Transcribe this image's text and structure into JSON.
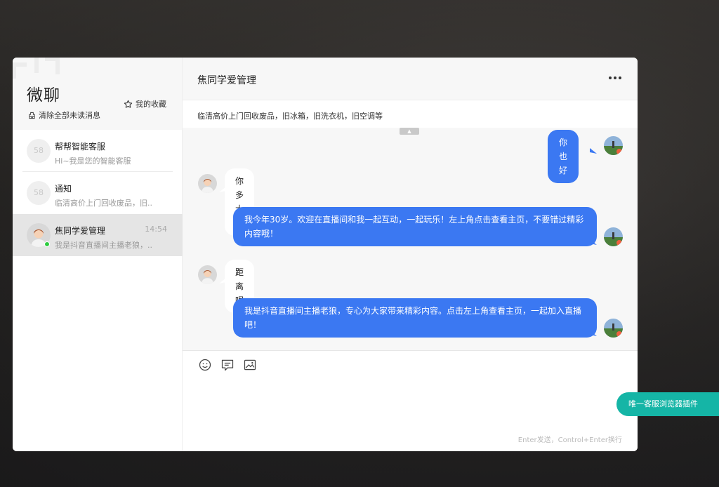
{
  "sidebar": {
    "title": "微聊",
    "clear_unread": "清除全部未读消息",
    "favorites": "我的收藏",
    "conversations": [
      {
        "name": "帮帮智能客服",
        "preview": "Hi~我是您的智能客服",
        "time": "",
        "avatar_text": "58"
      },
      {
        "name": "通知",
        "preview": "临清高价上门回收废品，旧...",
        "time": "",
        "avatar_text": "58"
      },
      {
        "name": "焦同学爱管理",
        "preview": "我是抖音直播间主播老狼，...",
        "time": "14:54",
        "avatar_text": ""
      }
    ]
  },
  "chat": {
    "title": "焦同学爱管理",
    "notice": "临清高价上门回收废品，旧冰箱，旧洗衣机，旧空调等",
    "collapse_glyph": "▲",
    "messages": [
      {
        "direction": "out",
        "text": "你也好"
      },
      {
        "direction": "in",
        "text": "你多大了"
      },
      {
        "direction": "out",
        "text": "我今年30岁。欢迎在直播间和我一起互动，一起玩乐！左上角点击查看主页，不要错过精彩内容哦！"
      },
      {
        "direction": "in",
        "text": "距离呢"
      },
      {
        "direction": "out",
        "text": "我是抖音直播间主播老狼，专心为大家带来精彩内容。点击左上角查看主页，一起加入直播吧！"
      }
    ]
  },
  "composer": {
    "hint": "Enter发送，Control+Enter换行",
    "tools": [
      "emoji-icon",
      "quick-reply-icon",
      "image-icon"
    ]
  },
  "plugin_button": "唯一客服浏览器插件",
  "colors": {
    "accent": "#3b78f2",
    "plugin": "#15b5a6",
    "online": "#2ecc40"
  }
}
